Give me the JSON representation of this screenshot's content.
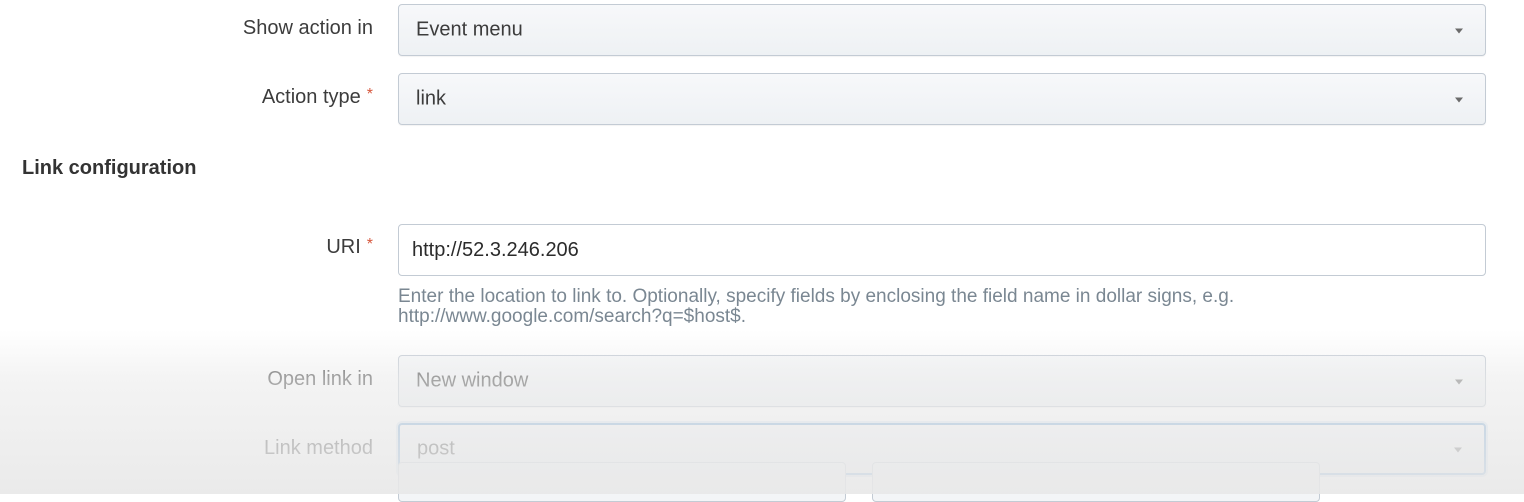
{
  "form": {
    "show_action_in": {
      "label": "Show action in",
      "value": "Event menu"
    },
    "action_type": {
      "label": "Action type",
      "required_mark": "*",
      "value": "link"
    },
    "link_configuration": {
      "heading": "Link configuration",
      "uri": {
        "label": "URI",
        "required_mark": "*",
        "value": "http://52.3.246.206",
        "help_line1": "Enter the location to link to. Optionally, specify fields by enclosing the field name in dollar signs, e.g.",
        "help_line2": "http://www.google.com/search?q=$host$."
      },
      "open_link_in": {
        "label": "Open link in",
        "value": "New window"
      },
      "link_method": {
        "label": "Link method",
        "value": "post"
      }
    }
  }
}
